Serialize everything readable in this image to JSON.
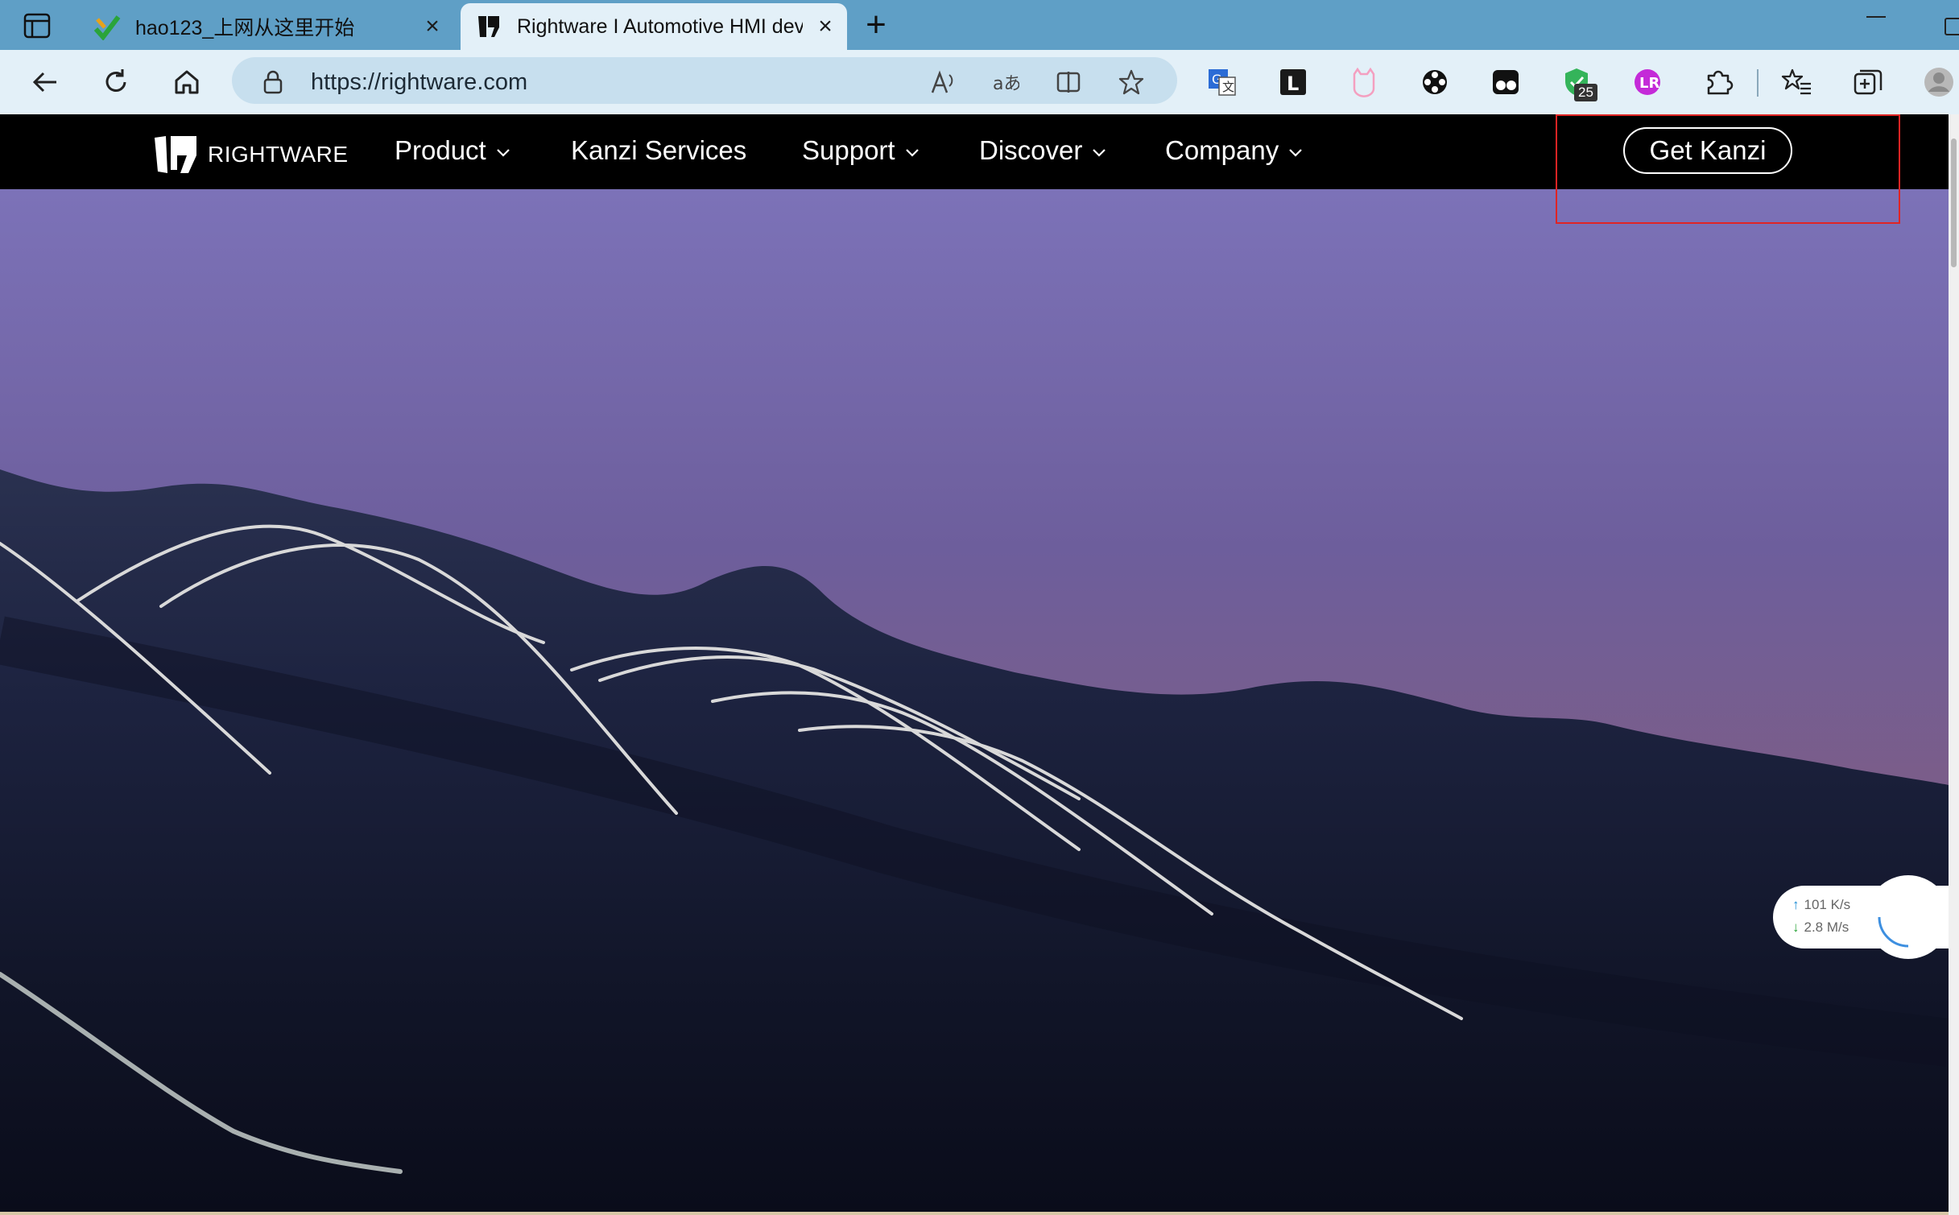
{
  "browser": {
    "tabs": [
      {
        "title": "hao123_上网从这里开始",
        "active": false
      },
      {
        "title": "Rightware I Automotive HMI dev",
        "active": true
      }
    ],
    "close_glyph": "×",
    "new_tab_glyph": "+",
    "address": {
      "url": "https://rightware.com"
    },
    "toolbar_icons": [
      "back-icon",
      "refresh-icon",
      "home-icon"
    ],
    "address_icons": [
      "lock-icon",
      "read-aloud-icon",
      "translate-icon",
      "split-screen-icon",
      "favorite-star-icon"
    ],
    "extensions": [
      "translate-ext-icon",
      "l-ext-icon",
      "cat-ext-icon",
      "film-ext-icon",
      "glasses-ext-icon",
      "shield-ext-icon",
      "purple-ext-icon",
      "extensions-puzzle-icon",
      "favorites-icon",
      "collections-icon",
      "profile-icon"
    ],
    "extension_badge": "25"
  },
  "site": {
    "logo_text": "RIGHTWARE",
    "nav": [
      {
        "label": "Product",
        "has_dropdown": true
      },
      {
        "label": "Kanzi Services",
        "has_dropdown": false
      },
      {
        "label": "Support",
        "has_dropdown": true
      },
      {
        "label": "Discover",
        "has_dropdown": true
      },
      {
        "label": "Company",
        "has_dropdown": true
      }
    ],
    "cta_label": "Get Kanzi"
  },
  "speed_widget": {
    "upload": "101 K/s",
    "download": "2.8  M/s"
  },
  "colors": {
    "tabstrip": "#5f9fc6",
    "toolbar": "#e3f0f8",
    "nav_bg": "#000000",
    "highlight": "#e02424"
  }
}
